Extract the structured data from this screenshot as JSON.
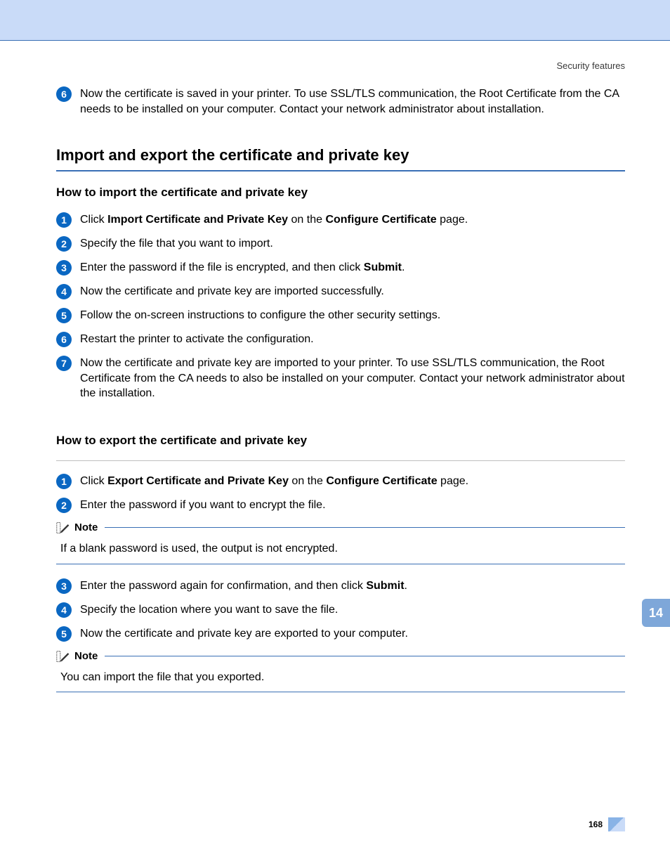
{
  "header": {
    "breadcrumb": "Security features"
  },
  "introStep": {
    "num": "6",
    "text": "Now the certificate is saved in your printer. To use SSL/TLS communication, the Root Certificate from the CA needs to be installed on your computer. Contact your network administrator about installation."
  },
  "section": {
    "title": "Import and export the certificate and private key",
    "importTitle": "How to import the certificate and private key",
    "importSteps": {
      "s1num": "1",
      "s1_a": "Click ",
      "s1_b": "Import Certificate and Private Key",
      "s1_c": " on the ",
      "s1_d": "Configure Certificate",
      "s1_e": " page.",
      "s2num": "2",
      "s2": "Specify the file that you want to import.",
      "s3num": "3",
      "s3_a": "Enter the password if the file is encrypted, and then click ",
      "s3_b": "Submit",
      "s3_c": ".",
      "s4num": "4",
      "s4": "Now the certificate and private key are imported successfully.",
      "s5num": "5",
      "s5": "Follow the on-screen instructions to configure the other security settings.",
      "s6num": "6",
      "s6": "Restart the printer to activate the configuration.",
      "s7num": "7",
      "s7": "Now the certificate and private key are imported to your printer. To use SSL/TLS communication, the Root Certificate from the CA needs to also be installed on your computer. Contact your network administrator about the installation."
    },
    "exportTitle": "How to export the certificate and private key",
    "exportSteps": {
      "s1num": "1",
      "s1_a": "Click ",
      "s1_b": "Export Certificate and Private Key",
      "s1_c": " on the ",
      "s1_d": "Configure Certificate",
      "s1_e": " page.",
      "s2num": "2",
      "s2": "Enter the password if you want to encrypt the file.",
      "s3num": "3",
      "s3_a": "Enter the password again for confirmation, and then click ",
      "s3_b": "Submit",
      "s3_c": ".",
      "s4num": "4",
      "s4": "Specify the location where you want to save the file.",
      "s5num": "5",
      "s5": "Now the certificate and private key are exported to your computer."
    }
  },
  "note1": {
    "label": "Note",
    "body": "If a blank password is used, the output is not encrypted."
  },
  "note2": {
    "label": "Note",
    "body": "You can import the file that you exported."
  },
  "sideTab": "14",
  "pageNumber": "168"
}
